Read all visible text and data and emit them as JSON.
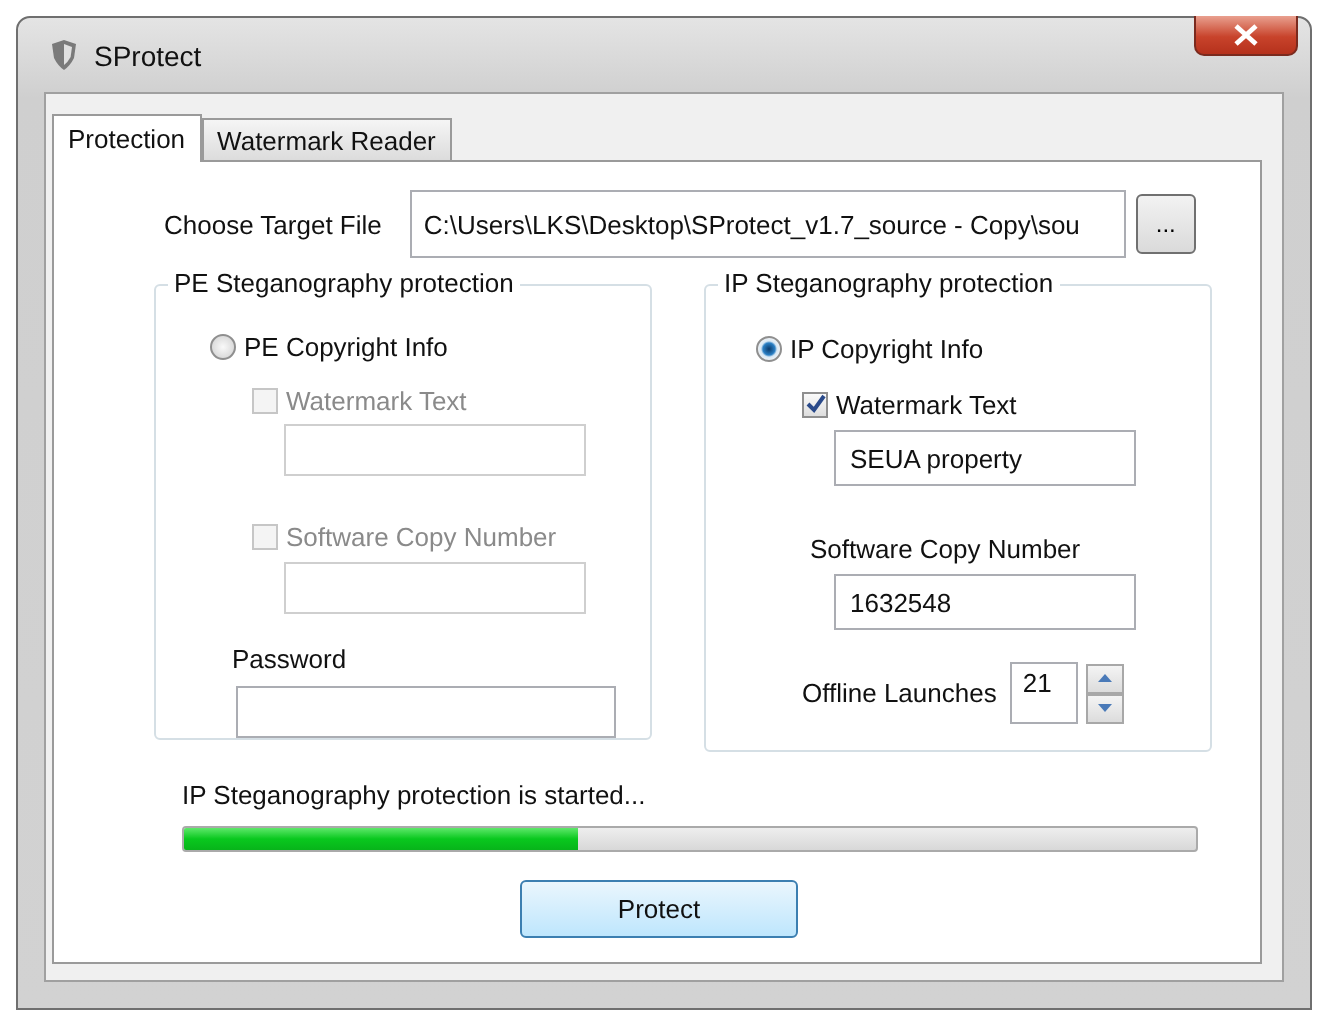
{
  "window": {
    "title": "SProtect"
  },
  "tabs": [
    {
      "label": "Protection",
      "selected": true
    },
    {
      "label": "Watermark Reader",
      "selected": false
    }
  ],
  "target_file": {
    "label": "Choose Target File",
    "value": "C:\\Users\\LKS\\Desktop\\SProtect_v1.7_source - Copy\\sou",
    "browse": "..."
  },
  "groups": [
    {
      "title": "PE Steganography protection",
      "option": {
        "label": "PE Copyright Info",
        "selected": false
      },
      "fields": [
        {
          "kind": "check",
          "label": "Watermark Text",
          "checked": false,
          "disabled": true
        },
        {
          "kind": "check",
          "label": "Software Copy Number",
          "checked": false,
          "disabled": true
        },
        {
          "kind": "plain",
          "label": "Password"
        }
      ]
    },
    {
      "title": "IP Steganography protection",
      "option": {
        "label": "IP Copyright Info",
        "selected": true
      },
      "fields": [
        {
          "kind": "check",
          "label": "Watermark Text",
          "checked": true,
          "disabled": false,
          "value": "SEUA property"
        },
        {
          "kind": "plain",
          "label": "Software Copy Number",
          "value": "1632548"
        },
        {
          "kind": "spin",
          "label": "Offline Launches",
          "value": "21"
        }
      ]
    }
  ],
  "status": "IP Steganography protection is started...",
  "progress": {
    "level": 0.39
  },
  "button": "Protect"
}
